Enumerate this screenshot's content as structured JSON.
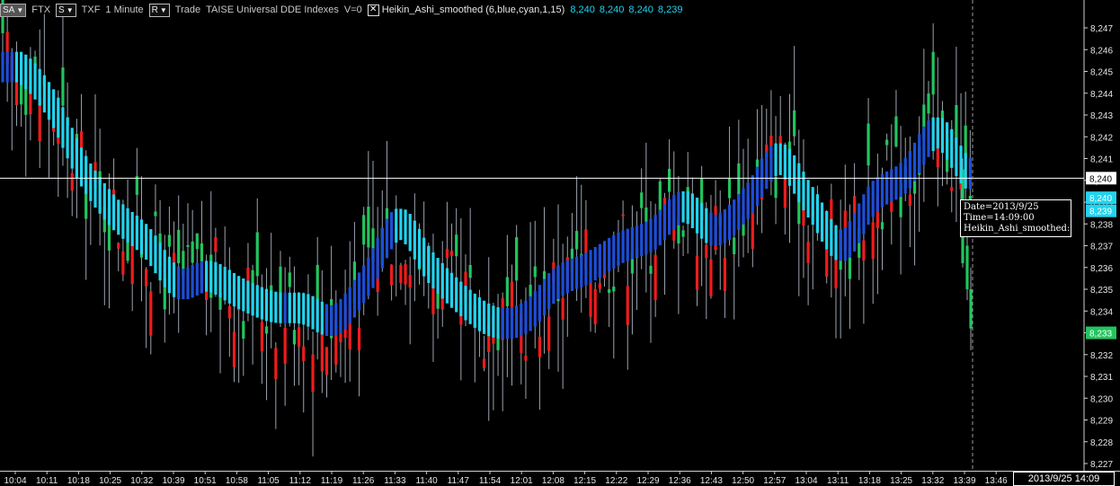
{
  "toolbar": {
    "sa_label": "SA",
    "exchange": "FTX",
    "s_label": "S",
    "symbol": "TXF",
    "interval": "1 Minute",
    "r_label": "R",
    "mode": "Trade",
    "feed": "TAISE Universal DDE Indexes",
    "volume": "V=0",
    "indicator_toggle": "✕",
    "indicator": "Heikin_Ashi_smoothed",
    "indicator_params": "(6,blue,cyan,1,15)",
    "values": [
      "8,240",
      "8,240",
      "8,240",
      "8,239"
    ]
  },
  "price_axis": {
    "labels": [
      "8,247",
      "8,246",
      "8,245",
      "8,244",
      "8,243",
      "8,242",
      "8,241",
      "8,240",
      "8,239",
      "8,238",
      "8,237",
      "8,236",
      "8,235",
      "8,234",
      "8,233",
      "8,232",
      "8,231",
      "8,230",
      "8,229",
      "8,228",
      "8,227"
    ],
    "markers": [
      {
        "price": 8240.1,
        "label": "8,240",
        "bg": "#ffffff",
        "color": "#000000"
      },
      {
        "price": 8239.2,
        "label": "8,240",
        "bg": "#22d3ee",
        "color": "#ffffff"
      },
      {
        "price": 8238.6,
        "label": "8,239",
        "bg": "#22d3ee",
        "color": "#ffffff"
      },
      {
        "price": 8233.0,
        "label": "8,233",
        "bg": "#22c55e",
        "color": "#ffffff"
      }
    ]
  },
  "time_axis": {
    "labels": [
      "10:04",
      "10:11",
      "10:18",
      "10:25",
      "10:32",
      "10:39",
      "10:51",
      "10:58",
      "11:05",
      "11:12",
      "11:19",
      "11:26",
      "11:33",
      "11:40",
      "11:47",
      "11:54",
      "12:01",
      "12:08",
      "12:15",
      "12:22",
      "12:29",
      "12:36",
      "12:43",
      "12:50",
      "12:57",
      "13:04",
      "13:11",
      "13:18",
      "13:25",
      "13:32",
      "13:39",
      "13:46"
    ]
  },
  "crosshair": {
    "price": 8240.1,
    "date_line": "Date=2013/9/25",
    "time_line": "Time=14:09:00",
    "indicator_line": "Heikin_Ashi_smoothed:",
    "time_stamp": "2013/9/25 14:09"
  },
  "chart_data": {
    "type": "candlestick",
    "title": "",
    "ylim": [
      8227.2,
      8247.5
    ],
    "colors": {
      "up": "#22c55e",
      "down": "#ef1c1c",
      "wick": "#9ca3af",
      "ha_up": "#22d3ee",
      "ha_down": "#1d4ed8"
    },
    "heikin_ashi_smoothed": [
      {
        "time": "10:04",
        "value": 8245.2
      },
      {
        "time": "10:11",
        "value": 8243.5
      },
      {
        "time": "10:18",
        "value": 8240.5
      },
      {
        "time": "10:25",
        "value": 8238.5
      },
      {
        "time": "10:32",
        "value": 8237.2
      },
      {
        "time": "10:39",
        "value": 8235.3
      },
      {
        "time": "10:51",
        "value": 8235.6
      },
      {
        "time": "10:58",
        "value": 8234.8
      },
      {
        "time": "11:05",
        "value": 8234.2
      },
      {
        "time": "11:12",
        "value": 8234.1
      },
      {
        "time": "11:19",
        "value": 8233.6
      },
      {
        "time": "11:26",
        "value": 8235.5
      },
      {
        "time": "11:33",
        "value": 8238.0
      },
      {
        "time": "11:40",
        "value": 8236.0
      },
      {
        "time": "11:47",
        "value": 8234.5
      },
      {
        "time": "11:54",
        "value": 8233.5
      },
      {
        "time": "12:01",
        "value": 8233.7
      },
      {
        "time": "12:08",
        "value": 8235.3
      },
      {
        "time": "12:15",
        "value": 8236.0
      },
      {
        "time": "12:22",
        "value": 8236.9
      },
      {
        "time": "12:29",
        "value": 8237.5
      },
      {
        "time": "12:36",
        "value": 8238.8
      },
      {
        "time": "12:43",
        "value": 8237.7
      },
      {
        "time": "12:50",
        "value": 8239.0
      },
      {
        "time": "12:57",
        "value": 8241.0
      },
      {
        "time": "13:04",
        "value": 8239.0
      },
      {
        "time": "13:11",
        "value": 8237.0
      },
      {
        "time": "13:18",
        "value": 8239.2
      },
      {
        "time": "13:25",
        "value": 8240.2
      },
      {
        "time": "13:32",
        "value": 8242.2
      },
      {
        "time": "13:39",
        "value": 8240.3
      }
    ]
  }
}
